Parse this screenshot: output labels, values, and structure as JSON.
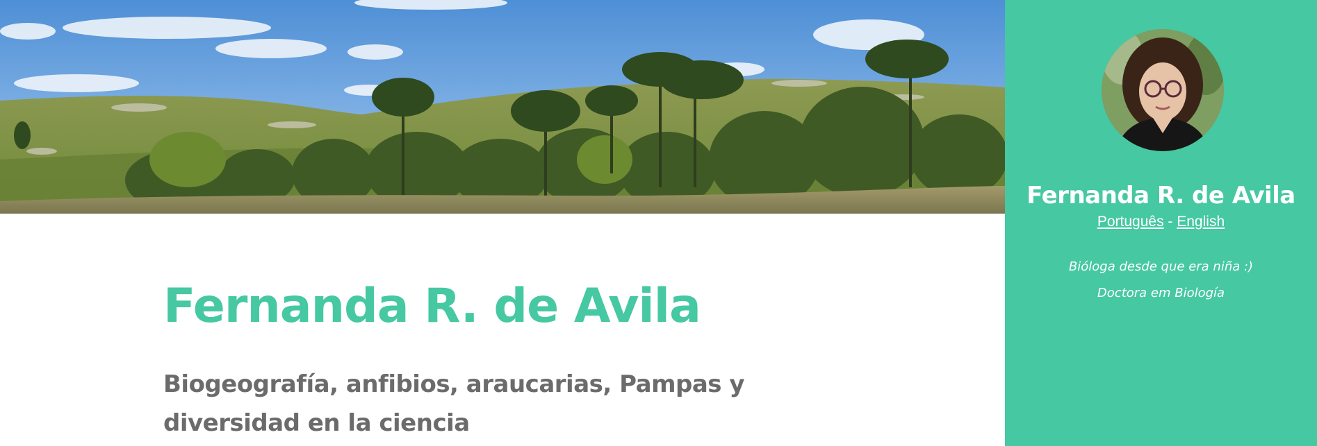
{
  "header": {
    "banner_image": "araucaria-grassland-landscape"
  },
  "main": {
    "title": "Fernanda R. de Avila",
    "subtitle": "Biogeografía, anfibios, araucarias, Pampas y diversidad en la ciencia"
  },
  "sidebar": {
    "avatar": "profile-photo",
    "name": "Fernanda R. de Avila",
    "languages": {
      "portuguese": "Português",
      "separator": " - ",
      "english": "English"
    },
    "bio": {
      "line1": "Bióloga desde que era niña :)",
      "line2": "Doctora em Biología"
    }
  },
  "colors": {
    "accent": "#46c8a2",
    "subtitle": "#6b6b6b",
    "sidebar_text": "#ffffff"
  }
}
